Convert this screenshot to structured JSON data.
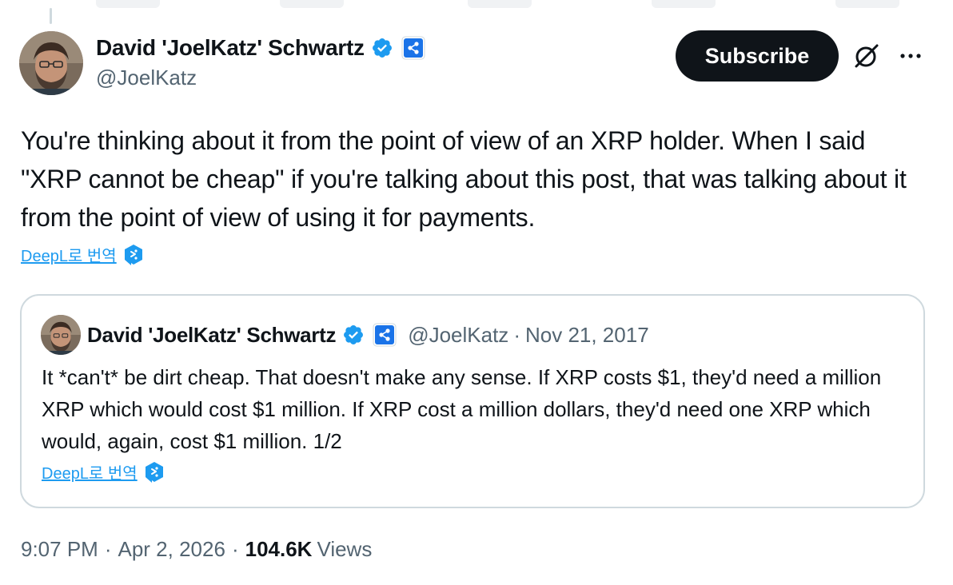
{
  "author": {
    "name": "David 'JoelKatz' Schwartz",
    "handle": "@JoelKatz"
  },
  "subscribe_label": "Subscribe",
  "tweet": {
    "text": "You're thinking about it from the point of view of an XRP holder. When I said \"XRP cannot be cheap\" if you're talking about this post, that was talking about it from the point of view of using it for payments.",
    "translate_label": "DeepL로 번역"
  },
  "quote": {
    "name": "David 'JoelKatz' Schwartz",
    "handle": "@JoelKatz",
    "separator": "·",
    "date": "Nov 21, 2017",
    "text": "It *can't* be dirt cheap. That doesn't make any sense. If XRP costs $1, they'd need a million XRP which would cost $1 million. If XRP cost a million dollars, they'd need one XRP which would, again, cost $1 million. 1/2",
    "translate_label": "DeepL로 번역"
  },
  "meta": {
    "time": "9:07 PM",
    "separator": "·",
    "date": "Apr 2, 2026",
    "views_count": "104.6K",
    "views_label": "Views"
  },
  "icons": {
    "verified": "verified-badge-icon",
    "affiliate": "ripple-affiliate-icon",
    "grok": "grok-icon",
    "more": "more-icon",
    "deepl": "deepl-icon"
  },
  "colors": {
    "accent": "#1d9bf0",
    "text": "#0f1419",
    "secondary": "#536471",
    "border": "#cfd9de",
    "button": "#0f1419"
  }
}
